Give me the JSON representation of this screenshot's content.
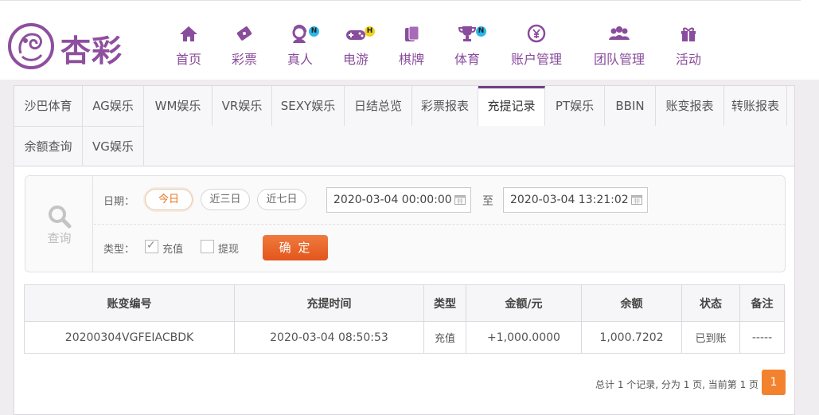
{
  "brand": {
    "name": "杏彩",
    "color": "#8e4f9e"
  },
  "nav": [
    {
      "label": "首页",
      "icon": "home-icon"
    },
    {
      "label": "彩票",
      "icon": "lottery-ticket-icon"
    },
    {
      "label": "真人",
      "icon": "live-dealer-icon",
      "badge": "N"
    },
    {
      "label": "电游",
      "icon": "gamepad-icon",
      "badge": "H"
    },
    {
      "label": "棋牌",
      "icon": "playing-cards-icon"
    },
    {
      "label": "体育",
      "icon": "trophy-icon",
      "badge": "N"
    },
    {
      "label": "账户管理",
      "icon": "yen-coin-icon"
    },
    {
      "label": "团队管理",
      "icon": "team-icon"
    },
    {
      "label": "活动",
      "icon": "gift-icon"
    }
  ],
  "tabs": [
    "沙巴体育",
    "AG娱乐",
    "WM娱乐",
    "VR娱乐",
    "SEXY娱乐",
    "日结总览",
    "彩票报表",
    "充提记录",
    "PT娱乐",
    "BBIN",
    "账变报表",
    "转账报表",
    "余额查询",
    "VG娱乐"
  ],
  "active_tab": "充提记录",
  "filter": {
    "side_label": "查询",
    "date_label": "日期：",
    "quick_ranges": [
      "今日",
      "近三日",
      "近七日"
    ],
    "active_range": "今日",
    "start": "2020-03-04 00:00:00",
    "separator": "至",
    "end": "2020-03-04 13:21:02",
    "type_label": "类型：",
    "types": [
      {
        "label": "充值",
        "checked": true
      },
      {
        "label": "提现",
        "checked": false
      }
    ],
    "confirm": "确 定"
  },
  "table": {
    "columns": [
      "账变编号",
      "充提时间",
      "类型",
      "金额/元",
      "余额",
      "状态",
      "备注"
    ],
    "rows": [
      [
        "20200304VGFEIACBDK",
        "2020-03-04 08:50:53",
        "充值",
        "+1,000.0000",
        "1,000.7202",
        "已到账",
        "-----"
      ]
    ]
  },
  "pagination": {
    "summary": "总计 1 个记录, 分为 1 页, 当前第 1 页",
    "current": "1"
  },
  "colors": {
    "accent": "#8a4c9c",
    "button": "#e8621f",
    "amount": "#d01f1f",
    "status_ok": "#2b9a2b"
  }
}
